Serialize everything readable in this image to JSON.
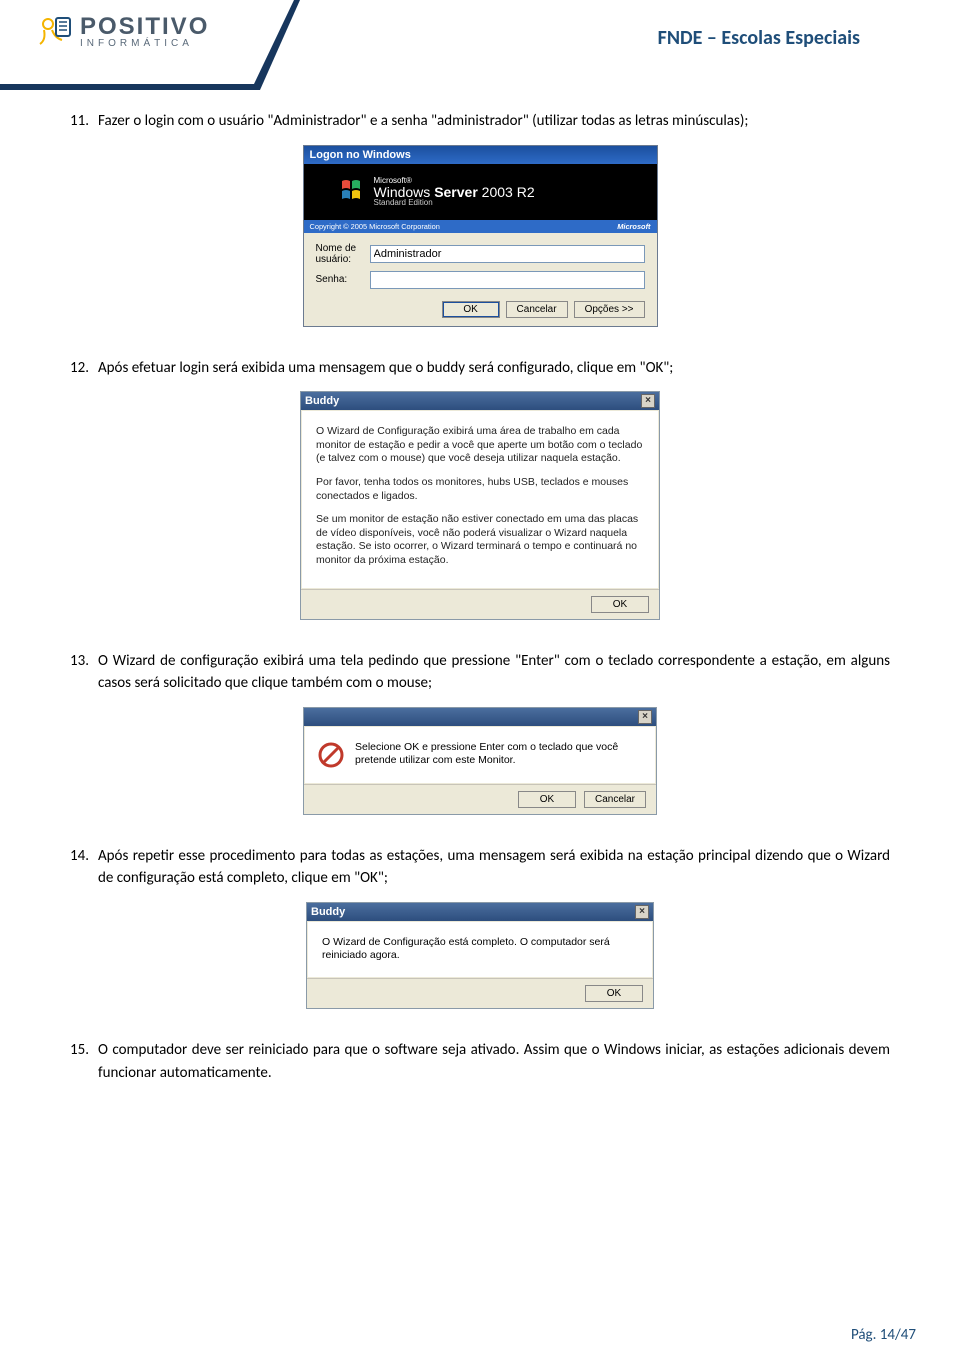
{
  "header": {
    "logo_main": "POSITIVO",
    "logo_sub": "INFORMÁTICA",
    "doc_title": "FNDE – Escolas Especiais"
  },
  "steps": {
    "s11": {
      "num": "11.",
      "text": "Fazer o login com o usuário \"Administrador\" e a senha \"administrador\" (utilizar todas as letras minúsculas);"
    },
    "s12": {
      "num": "12.",
      "text": "Após efetuar login será exibida uma mensagem que o buddy será configurado, clique em \"OK\";"
    },
    "s13": {
      "num": "13.",
      "text": "O Wizard de configuração exibirá uma tela pedindo que pressione \"Enter\" com o teclado correspondente a estação, em alguns casos será solicitado que clique também com o mouse;"
    },
    "s14": {
      "num": "14.",
      "text": "Após repetir esse procedimento para todas as estações, uma mensagem será exibida na estação principal dizendo que o Wizard de configuração está completo, clique em \"OK\";"
    },
    "s15": {
      "num": "15.",
      "text": "O computador deve ser reiniciado para que o software seja ativado. Assim que o Windows iniciar, as estações adicionais devem funcionar automaticamente."
    }
  },
  "fig1": {
    "title": "Logon no Windows",
    "ms": "Microsoft®",
    "product1": "Windows ",
    "product2": "Server",
    "product3": " 2003 R2",
    "edition": "Standard Edition",
    "copyright": "Copyright © 2005 Microsoft Corporation",
    "ms_brand": "Microsoft",
    "lbl_user": "Nome de usuário:",
    "lbl_pass": "Senha:",
    "val_user": "Administrador",
    "btn_ok": "OK",
    "btn_cancel": "Cancelar",
    "btn_opts": "Opções >>"
  },
  "fig2": {
    "title": "Buddy",
    "p1": "O Wizard de Configuração exibirá uma área de trabalho em cada monitor de estação e pedir a você que aperte um botão com o teclado (e talvez com o mouse) que você deseja utilizar naquela estação.",
    "p2": "Por favor, tenha todos os monitores, hubs USB, teclados e mouses conectados e ligados.",
    "p3": "Se um monitor de estação não estiver conectado em uma das placas de vídeo disponíveis, você não poderá visualizar o Wizard naquela estação. Se isto ocorrer, o Wizard terminará o tempo e continuará no monitor da próxima estação.",
    "btn_ok": "OK"
  },
  "fig3": {
    "msg": "Selecione OK e pressione Enter com o teclado que você pretende utilizar com este Monitor.",
    "btn_ok": "OK",
    "btn_cancel": "Cancelar"
  },
  "fig4": {
    "title": "Buddy",
    "msg": "O Wizard de Configuração está completo. O computador será reiniciado agora.",
    "btn_ok": "OK"
  },
  "footer": {
    "page": "Pág. 14/47"
  }
}
